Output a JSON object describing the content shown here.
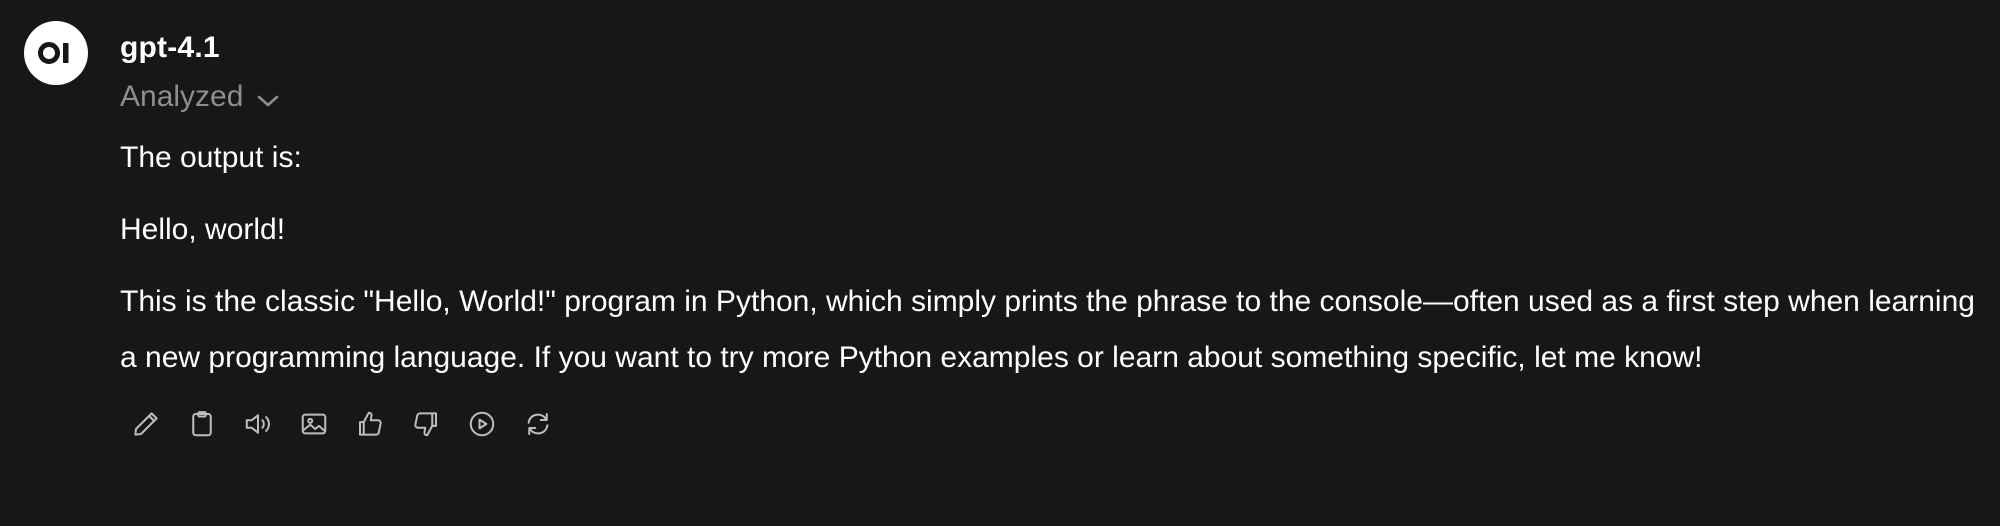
{
  "message": {
    "avatar_icon": "openwebui-logo-icon",
    "model_name": "gpt-4.1",
    "status_label": "Analyzed",
    "paragraphs": [
      "The output is:",
      "Hello, world!",
      "This is the classic \"Hello, World!\" program in Python, which simply prints the phrase to the console—often used as a first step when learning a new programming language. If you want to try more Python examples or learn about something specific, let me know!"
    ]
  },
  "toolbar": {
    "icons": [
      "edit-icon",
      "copy-icon",
      "read-aloud-icon",
      "image-icon",
      "thumbs-up-icon",
      "thumbs-down-icon",
      "play-icon",
      "regenerate-icon"
    ]
  },
  "colors": {
    "background": "#171717",
    "text": "#ffffff",
    "muted": "#8e8e8e",
    "icon": "#bdbdbd"
  }
}
